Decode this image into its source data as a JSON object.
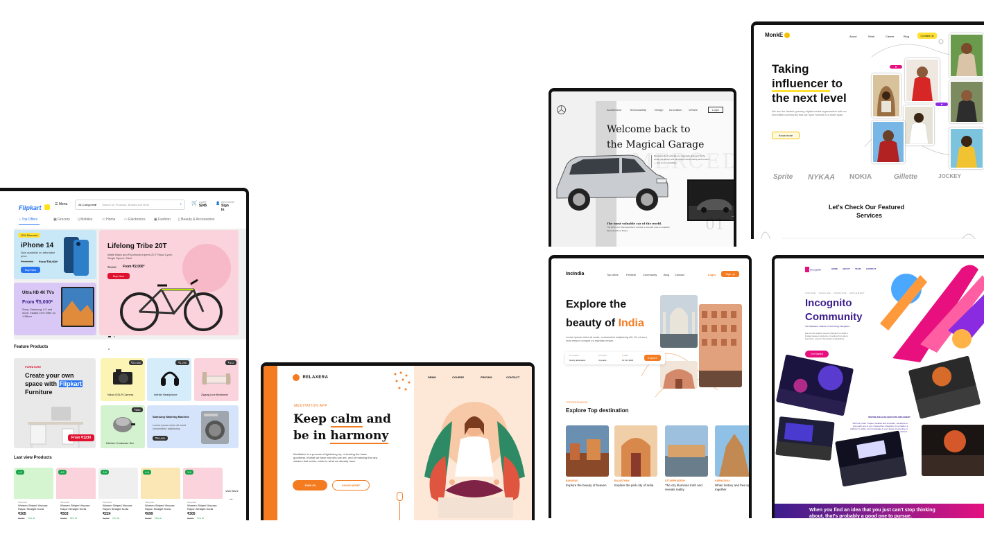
{
  "flipkart": {
    "logo": "Flipkart",
    "menu_label": "Menu",
    "category_select": "All Categories",
    "search_placeholder": "Search for Products, Brands and More",
    "cart_label": "CART",
    "cart_value": "$245",
    "account_label": "ACCOUNT",
    "signin_label": "Sign in",
    "nav": [
      "Top Offers",
      "Grocery",
      "Mobiles",
      "Home",
      "Electronics",
      "Fashion",
      "Beauty & Accessories"
    ],
    "promo1": {
      "badge": "10% Discount",
      "title": "iPhone 14",
      "desc": "Now available on affordable price",
      "old_price": "₹1,00,000",
      "price": "From ₹99,900*",
      "cta": "Buy Now"
    },
    "promo2": {
      "title": "Ultra HD 4K TVs",
      "price": "From ₹5,000*",
      "desc": "Sony, Samsung, LG and more. Instant 10% Offer on 1.5Bum"
    },
    "promo3": {
      "title": "Lifelong Tribe 20T",
      "desc": "Matte Black and Fluorescent green 20 T Road Cycle, Single Speed, Steel",
      "old_price": "₹5,000",
      "price": "From ₹2,000*",
      "cta": "Buy Now"
    },
    "feature_title": "Feature Products",
    "furniture": {
      "tag": "FURNITURE",
      "line1": "Create your own",
      "line2": "space with",
      "highlight": "Flipkart",
      "line3": "Furniture",
      "price": "From ₹1230"
    },
    "products": [
      {
        "name": "Nikon DSLR Camera",
        "price": "₹23,000"
      },
      {
        "name": "Infinite Headphone",
        "price": "₹1,200"
      },
      {
        "name": "Zigzag Line Bedsheet",
        "price": "₹412"
      },
      {
        "name": "Kitchen Cookware Set",
        "price": "₹665"
      }
    ],
    "washer": {
      "name": "Samsung Washing Machine",
      "desc": "Lorem ipsum dolor sit amet consectetur adipiscing",
      "price": "₹55,000"
    },
    "last_view_title": "Last view Products",
    "last_view": [
      {
        "rating": "4.2",
        "brand": "Sleepwell",
        "name": "Women Striped Viscose Rayon Straight Kurta",
        "price": "₹305",
        "old": "₹1,050",
        "off": "70% off"
      },
      {
        "rating": "4.5",
        "brand": "Sleepwell",
        "name": "Women Striped Viscose Rayon Straight Kurta",
        "price": "₹503",
        "old": "₹1,050",
        "off": "55% off"
      },
      {
        "rating": "3.8",
        "brand": "Sleepwell",
        "name": "Women Striped Viscose Rayon Straight Kurta",
        "price": "₹224",
        "old": "₹1,050",
        "off": "70% off"
      },
      {
        "rating": "4.6",
        "brand": "Sleepwell",
        "name": "Women Striped Viscose Rayon Straight Kurta",
        "price": "₹699",
        "old": "₹1,050",
        "off": "35% off"
      },
      {
        "rating": "3.9",
        "brand": "Sleepwell",
        "name": "Women Striped Viscose Rayon Straight Kurta",
        "price": "₹305",
        "old": "₹1,050",
        "off": "70% off"
      }
    ],
    "view_more": "View More"
  },
  "relaxera": {
    "logo": "RELAXERA",
    "nav": [
      "DEMO",
      "COURSE",
      "PRICING",
      "CONTACT"
    ],
    "eyebrow": "MEDITATION APP",
    "title1_pre": "Keep ",
    "title1_em": "calm",
    "title1_post": " and",
    "title2_pre": "be in ",
    "title2_em": "harmony",
    "body": "Meditation is a process of lightening up, of trusting the basic goodness of what we have and who we are, and of realizing that any wisdom that exists, exists in what we already have.",
    "cta1": "JOIN US",
    "cta2": "KNOW MORE"
  },
  "garage": {
    "nav": [
      "Architecture",
      "Technicability",
      "Design",
      "Innovation",
      "Vehicle"
    ],
    "login": "Login",
    "title1": "Welcome back to",
    "title2": "the Magical Garage",
    "desc": "Mercedes-Benz vehicles are especially designed for the whole, the design and ultimately ensures safety and comfort — and more possibilities.",
    "caption_title": "The most valuable car of the world.",
    "caption_body": "The 2015 GLK Mercedes-Benz exhibits a renewed price to establish Mercedes-Benz Brand.",
    "counter": "01"
  },
  "monke": {
    "logo": "MonkE",
    "nav": [
      "About",
      "Work",
      "Career",
      "Blog"
    ],
    "contact": "Contact us",
    "title1": "Taking",
    "title2": "influencer to",
    "title3": "the next level",
    "desc": "We are the fastest growing digital media organization with an incredible community that we have formed in a short span.",
    "cta": "Know more",
    "brands": [
      "Sprite",
      "NYKAA",
      "NOKIA",
      "Gillette",
      "JOCKEY"
    ],
    "featured1": "Let's Check Our Featured",
    "featured2": "Services"
  },
  "incredible": {
    "logo": "IncIndia",
    "nav": [
      "Top cities",
      "Festival",
      "Community",
      "Blog",
      "Contact"
    ],
    "login": "Login",
    "signup": "Sign up",
    "title1": "Explore the",
    "title2_pre": "beauty of ",
    "title2_em": "India",
    "desc": "Lorem ipsum dolor sit amet, consectetur adipiscing elit. Eu ut arcu, cras tempor congue eu egestas neque.",
    "fields": [
      {
        "label": "Location",
        "value": "Going destination"
      },
      {
        "label": "People",
        "value": "4 people"
      },
      {
        "label": "Date",
        "value": "10 Oct 2022"
      }
    ],
    "explore_btn": "Explore",
    "eyebrow": "TOP DESTINATION",
    "section_title": "Explore Top destination",
    "cards": [
      {
        "tag": "BANARAS",
        "title": "Explore the beauty of heaven"
      },
      {
        "tag": "RAJASTHAN",
        "title": "Explore the pink city of India"
      },
      {
        "tag": "UTTARPRADESH",
        "title": "The city Illumines truth and reveals reality"
      },
      {
        "tag": "KARNATAKA",
        "title": "When history and free spirits together"
      }
    ]
  },
  "incognito": {
    "logo": "incognito",
    "nav": [
      "HOME",
      "ABOUT",
      "TEAM",
      "CONTACT"
    ],
    "eyebrow": "INSPIRE · IDEALIZE · INNOVATE · IMPLEMENT",
    "title1": "Incognito",
    "title2": "Community",
    "sub": "Shri Mahadevi Institute of Technology Bangalore",
    "desc": "We are the student society that aims to build a bridge between students, providing the tools to help them excel in their desired disciplines.",
    "cta": "Get Started",
    "motto_head": "INSPIRE.IDEALIZE.INNOVATE.IMPLEMENT",
    "motto": "With our motto \"Inspire, Idealize and Innovate\", we aspire to give each one of you, irrespective a beginner or a master, a platform to widen your knowledge in your areas of expertise or interest.",
    "banner": "When you find an idea that you just can't stop thinking about, that's probably a good one to pursue."
  },
  "colors": {
    "flipkart_blue": "#2874f0",
    "flipkart_yellow": "#ffe11b",
    "orange": "#f47b20",
    "indigo": "#3c1e8c",
    "magenta": "#e8107f",
    "yellow": "#ffe033"
  }
}
